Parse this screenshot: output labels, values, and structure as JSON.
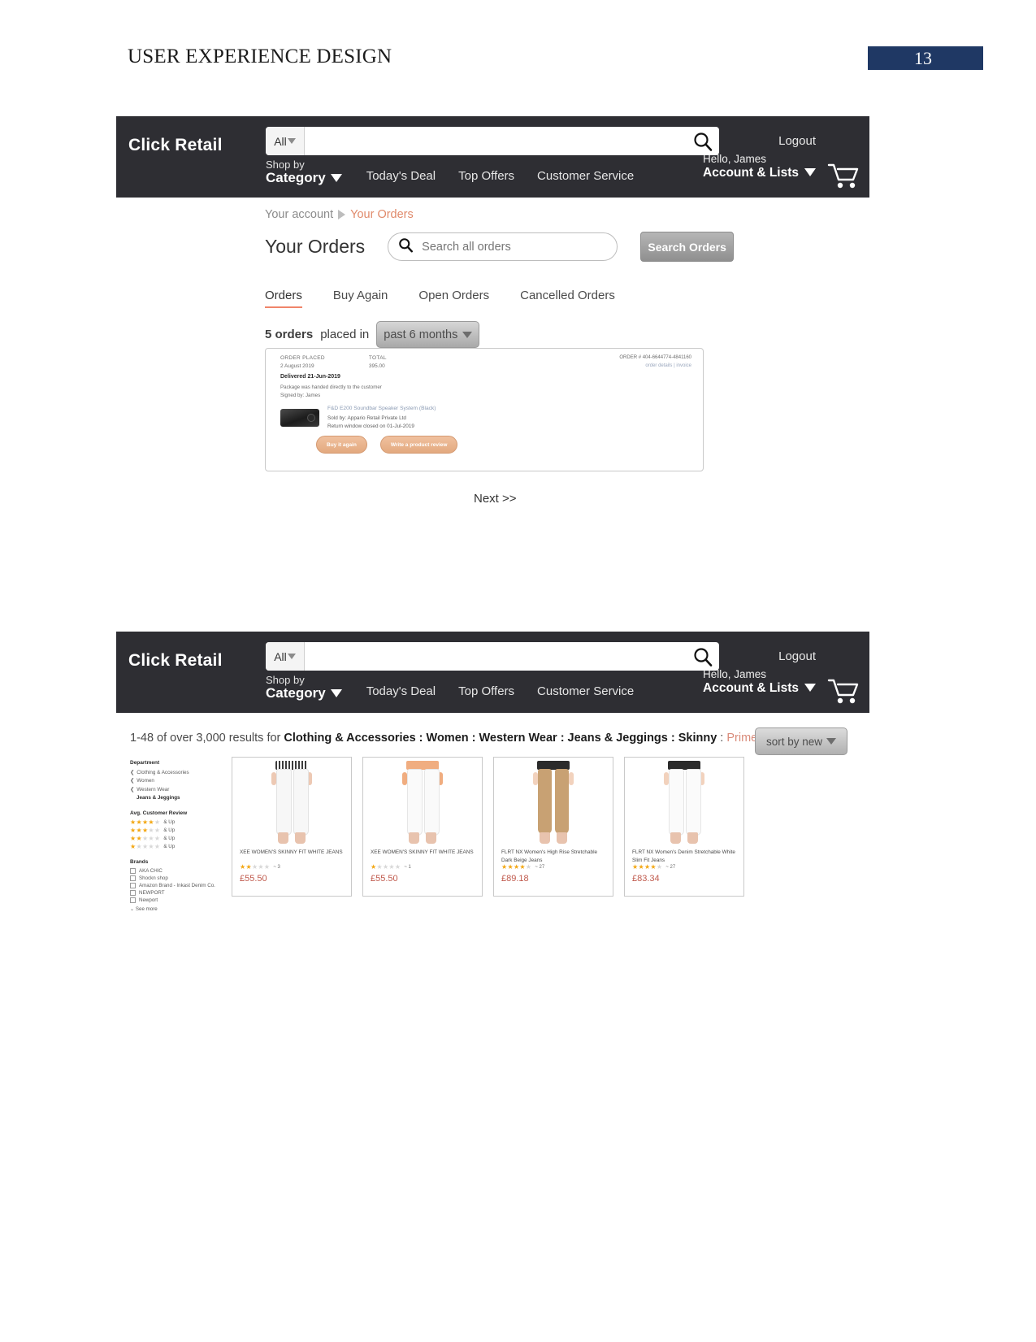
{
  "slide": {
    "title": "USER EXPERIENCE DESIGN",
    "page_number": "13",
    "badge_color": "#1f3864"
  },
  "header": {
    "brand": "Click Retail",
    "search": {
      "category_label": "All",
      "value": "",
      "placeholder": "",
      "icon": "search-icon"
    },
    "logout_label": "Logout",
    "shop_by_small": "Shop by",
    "shop_by_big": "Category",
    "nav_links": [
      "Today's Deal",
      "Top Offers",
      "Customer Service"
    ],
    "account_greeting": "Hello, James",
    "account_label": "Account & Lists",
    "cart_icon": "shopping-cart-icon",
    "background": "#2e2e33"
  },
  "orders_page": {
    "breadcrumb": {
      "root": "Your account",
      "separator_icon": "triangle-right-icon",
      "current": "Your Orders",
      "current_color": "#e08a6b"
    },
    "title": "Your Orders",
    "search": {
      "placeholder": "Search all orders",
      "value": "",
      "icon": "search-icon"
    },
    "search_button": "Search Orders",
    "tabs": [
      {
        "label": "Orders",
        "active": true
      },
      {
        "label": "Buy Again",
        "active": false
      },
      {
        "label": "Open Orders",
        "active": false
      },
      {
        "label": "Cancelled Orders",
        "active": false
      }
    ],
    "count_prefix": "5 orders",
    "count_suffix": "placed in",
    "period": "past 6 months",
    "order": {
      "col_order_placed_label": "ORDER PLACED",
      "col_order_placed_value": "2 August 2019",
      "col_total_label": "TOTAL",
      "col_total_value": "395.00",
      "order_number": "ORDER # 404-6644774-4841160",
      "links": "order details  |  invoice",
      "delivered": "Delivered 21-Jun-2019",
      "note_line1": "Package was handed directly to the customer",
      "note_line2": "Signed by: James",
      "product_title": "F&D E200 Soundbar Speaker System (Black)",
      "sold_by": "Sold by: Appario Retail Private Ltd",
      "return_window": "Return window closed on 01-Jul-2019",
      "buy_again_button": "Buy it again",
      "review_button": "Write a product review",
      "thumb_icon": "soundbar-speaker-thumbnail"
    },
    "next_link": "Next >>"
  },
  "results_page": {
    "results_prefix": "1-48 of over 3,000 results for ",
    "results_query": "Clothing & Accessories : Women : Western Wear : Jeans & Jeggings : Skinny",
    "results_separator": " : ",
    "prime_label": "Prime Eligible",
    "sort_button": "sort by new",
    "facets": {
      "department_head": "Department",
      "department_items": [
        {
          "label": "Clothing & Accessories",
          "chevron": true,
          "bold": false
        },
        {
          "label": "Women",
          "chevron": true,
          "bold": false
        },
        {
          "label": "Western Wear",
          "chevron": true,
          "bold": false
        },
        {
          "label": "Jeans & Jeggings",
          "chevron": false,
          "bold": true
        }
      ],
      "review_head": "Avg. Customer Review",
      "review_items": [
        {
          "filled": 4,
          "label": "& Up"
        },
        {
          "filled": 3,
          "label": "& Up"
        },
        {
          "filled": 2,
          "label": "& Up"
        },
        {
          "filled": 1,
          "label": "& Up"
        }
      ],
      "brands_head": "Brands",
      "brands": [
        "AKA CHIC",
        "Shockn shop",
        "Amazon Brand - Inkast Denim Co.",
        "NEWPORT",
        "Newport"
      ],
      "see_more": "See more"
    },
    "products": [
      {
        "title": "XEE WOMEN'S SKINNY FIT WHITE JEANS",
        "stars_filled": 2,
        "review_count": "3",
        "price": "£55.50",
        "jeans_color": "#f7f7f7",
        "waist_color": "#3c3c3c",
        "image_name": "white-skinny-jeans-photo"
      },
      {
        "title": "XEE WOMEN'S SKINNY FIT WHITE JEANS",
        "stars_filled": 1,
        "review_count": "1",
        "price": "£55.50",
        "jeans_color": "#fafafa",
        "waist_color": "#f0ad80",
        "image_name": "white-skinny-jeans-photo"
      },
      {
        "title": "FLRT NX Women's High Rise Stretchable Dark Beige Jeans",
        "stars_filled": 4,
        "review_count": "27",
        "price": "£89.18",
        "jeans_color": "#c8a173",
        "waist_color": "#2b2b2b",
        "image_name": "beige-jeans-photo"
      },
      {
        "title": "FLRT NX Women's Denim Stretchable White Slim Fit Jeans",
        "stars_filled": 4,
        "review_count": "27",
        "price": "£83.34",
        "jeans_color": "#fbfbfb",
        "waist_color": "#2b2b2b",
        "image_name": "white-slim-jeans-photo"
      }
    ]
  }
}
